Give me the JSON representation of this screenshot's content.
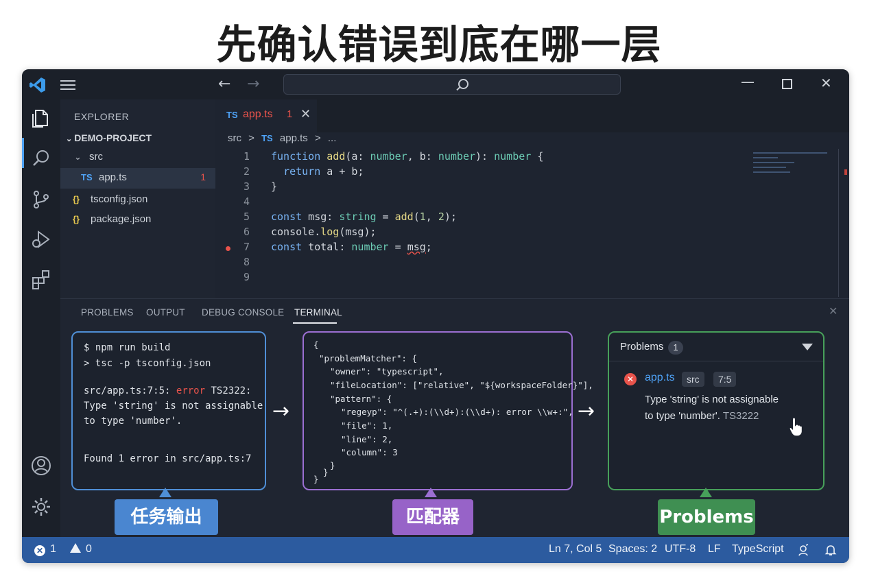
{
  "headline": "先确认错误到底在哪一层",
  "colors": {
    "accent": "#4fa3f7",
    "error": "#e8534b",
    "status_bar": "#2c5b9f",
    "terminal_border": "#4f8fd6",
    "matcher_border": "#9b6fd2",
    "problems_border": "#47a05a"
  },
  "titlebar": {
    "logo_icon": "vscode-logo-icon",
    "back": "←",
    "forward": "→",
    "minimize": "—",
    "close": "✕"
  },
  "sidebar": {
    "title": "EXPLORER",
    "project": "DEMO-PROJECT",
    "items": [
      {
        "icon": "⌄",
        "label": "src"
      },
      {
        "icon": "TS",
        "label": "app.ts",
        "badge": "1"
      },
      {
        "icon": "{}",
        "label": "tsconfig.json"
      },
      {
        "icon": "{}",
        "label": "package.json"
      }
    ]
  },
  "editor": {
    "tab": {
      "lang": "TS",
      "name": "app.ts",
      "badge": "1",
      "close": "✕"
    },
    "breadcrumbs": [
      "src",
      ">",
      "TS",
      "app.ts",
      ">",
      "..."
    ],
    "lines": [
      {
        "num": "1"
      },
      {
        "num": "2"
      },
      {
        "num": "3"
      },
      {
        "num": "4"
      },
      {
        "num": "5"
      },
      {
        "num": "6"
      },
      {
        "num": "7"
      },
      {
        "num": "8"
      },
      {
        "num": "9"
      }
    ]
  },
  "panel": {
    "tabs": [
      "PROBLEMS",
      "OUTPUT",
      "DEBUG CONSOLE",
      "TERMINAL"
    ],
    "close": "✕",
    "terminal": {
      "lines": [
        "$ npm run build",
        "> tsc -p tsconfig.json",
        "src/app.ts:7:5",
        ":",
        "error",
        "TS2322:",
        "Type 'string' is not assignable",
        "to type 'number'.",
        "Found 1 error in src/app.ts:7"
      ]
    },
    "matcher": {
      "lines": [
        "{",
        "\"problemMatcher\": {",
        "\"owner\": \"typescript\",",
        "\"fileLocation\": [\"relative\", \"${workspaceFolder}\"],",
        "\"pattern\": {",
        "\"regeyp\": \"^(.+):(\\\\d+):(\\\\d+): error \\\\w+:\",",
        "\"file\": 1,",
        "\"line\": 2,",
        "\"column\": 3",
        "}",
        "}",
        "}"
      ]
    },
    "problems": {
      "title": "Problems",
      "count": "1",
      "file": "app.ts",
      "folder": "src",
      "position": "7:5",
      "message_line1": "Type 'string' is not assignable",
      "message_line2": "to type 'number'.",
      "code": "TS3222"
    },
    "arrow": "→"
  },
  "labels": {
    "terminal": "任务输出",
    "matcher": "匹配器",
    "problems": "Problems"
  },
  "statusbar": {
    "errors": "1",
    "warnings": "0",
    "position": "Ln 7, Col 5",
    "spaces": "Spaces: 2",
    "encoding": "UTF-8",
    "eol": "LF",
    "language": "TypeScript"
  }
}
